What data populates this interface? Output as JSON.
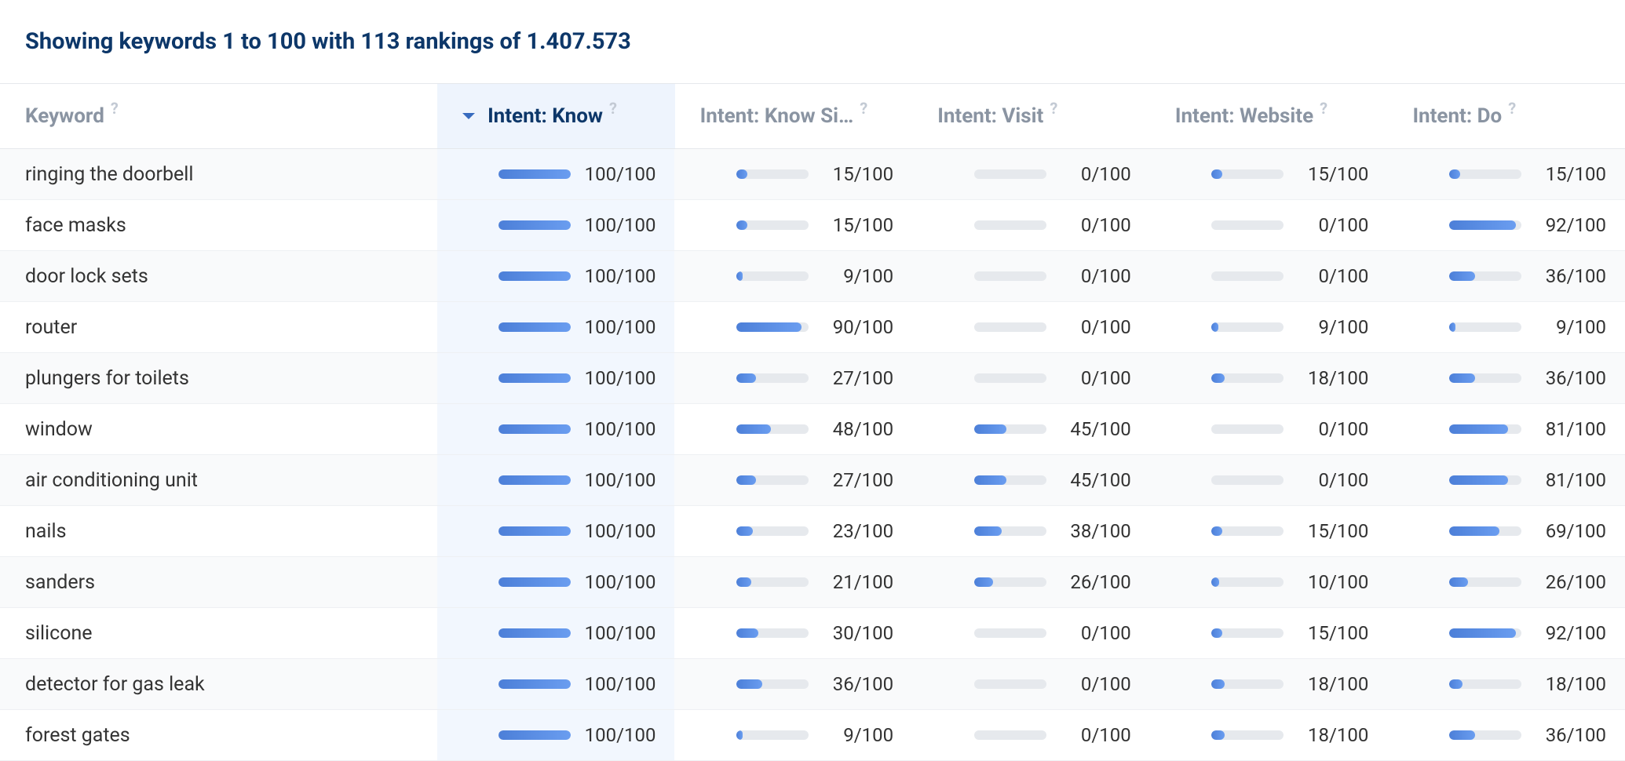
{
  "header": {
    "text": "Showing keywords 1 to 100 with 113 rankings of 1.407.573"
  },
  "columns": [
    {
      "label": "Keyword",
      "help": true,
      "sorted": false
    },
    {
      "label": "Intent: Know",
      "help": true,
      "sorted": true
    },
    {
      "label": "Intent: Know Si…",
      "help": true,
      "sorted": false
    },
    {
      "label": "Intent: Visit",
      "help": true,
      "sorted": false
    },
    {
      "label": "Intent: Website",
      "help": true,
      "sorted": false
    },
    {
      "label": "Intent: Do",
      "help": true,
      "sorted": false
    }
  ],
  "value_suffix": "/100",
  "rows": [
    {
      "keyword": "ringing the doorbell",
      "know": 100,
      "know_si": 15,
      "visit": 0,
      "website": 15,
      "do": 15
    },
    {
      "keyword": "face masks",
      "know": 100,
      "know_si": 15,
      "visit": 0,
      "website": 0,
      "do": 92
    },
    {
      "keyword": "door lock sets",
      "know": 100,
      "know_si": 9,
      "visit": 0,
      "website": 0,
      "do": 36
    },
    {
      "keyword": "router",
      "know": 100,
      "know_si": 90,
      "visit": 0,
      "website": 9,
      "do": 9
    },
    {
      "keyword": "plungers for toilets",
      "know": 100,
      "know_si": 27,
      "visit": 0,
      "website": 18,
      "do": 36
    },
    {
      "keyword": "window",
      "know": 100,
      "know_si": 48,
      "visit": 45,
      "website": 0,
      "do": 81
    },
    {
      "keyword": "air conditioning unit",
      "know": 100,
      "know_si": 27,
      "visit": 45,
      "website": 0,
      "do": 81
    },
    {
      "keyword": "nails",
      "know": 100,
      "know_si": 23,
      "visit": 38,
      "website": 15,
      "do": 69
    },
    {
      "keyword": "sanders",
      "know": 100,
      "know_si": 21,
      "visit": 26,
      "website": 10,
      "do": 26
    },
    {
      "keyword": "silicone",
      "know": 100,
      "know_si": 30,
      "visit": 0,
      "website": 15,
      "do": 92
    },
    {
      "keyword": "detector for gas leak",
      "know": 100,
      "know_si": 36,
      "visit": 0,
      "website": 18,
      "do": 18
    },
    {
      "keyword": "forest gates",
      "know": 100,
      "know_si": 9,
      "visit": 0,
      "website": 18,
      "do": 36
    }
  ]
}
